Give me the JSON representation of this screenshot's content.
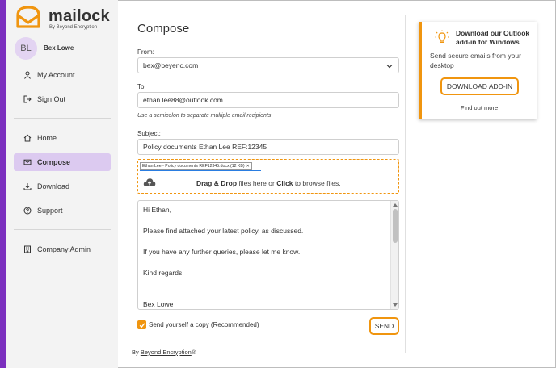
{
  "brand": {
    "name": "mailock",
    "tagline": "By Beyond Encryption"
  },
  "user": {
    "initials": "BL",
    "name": "Bex Lowe"
  },
  "sidebar": {
    "account_items": [
      {
        "label": "My Account",
        "icon": "person-icon"
      },
      {
        "label": "Sign Out",
        "icon": "sign-out-icon"
      }
    ],
    "nav_items": [
      {
        "label": "Home",
        "icon": "home-icon"
      },
      {
        "label": "Compose",
        "icon": "envelope-icon",
        "active": true
      },
      {
        "label": "Download",
        "icon": "download-icon"
      },
      {
        "label": "Support",
        "icon": "help-icon"
      }
    ],
    "admin_items": [
      {
        "label": "Company Admin",
        "icon": "building-icon"
      }
    ]
  },
  "compose": {
    "title": "Compose",
    "from_label": "From:",
    "from_value": "bex@beyenc.com",
    "to_label": "To:",
    "to_value": "ethan.lee88@outlook.com",
    "to_hint": "Use a semicolon to separate multiple email recipients",
    "subject_label": "Subject:",
    "subject_value": "Policy documents Ethan Lee REF:12345",
    "attachment": "Ethan Lee - Policy documents REF12345.docx (12 KB)",
    "attachment_remove": "✕",
    "drop_bold1": "Drag & Drop",
    "drop_mid": " files here or ",
    "drop_bold2": "Click",
    "drop_end": " to browse files.",
    "message_lines": [
      "Hi Ethan,",
      "Please find attached your latest policy, as discussed.",
      "If you have any further queries, please let me know.",
      "Kind regards,",
      "Bex Lowe"
    ],
    "copy_label": "Send yourself a copy (Recommended)",
    "copy_checked": true,
    "send_label": "SEND"
  },
  "footer": {
    "prefix": "By ",
    "link": "Beyond Encryption",
    "suffix": "®"
  },
  "promo": {
    "title": "Download our Outlook add-in for Windows",
    "text": "Send secure emails from your desktop",
    "button": "DOWNLOAD ADD-IN",
    "link": "Find out more"
  },
  "colors": {
    "accent": "#f0950f",
    "brand_purple": "#7b2fbe",
    "active_nav": "#dccaf0"
  }
}
